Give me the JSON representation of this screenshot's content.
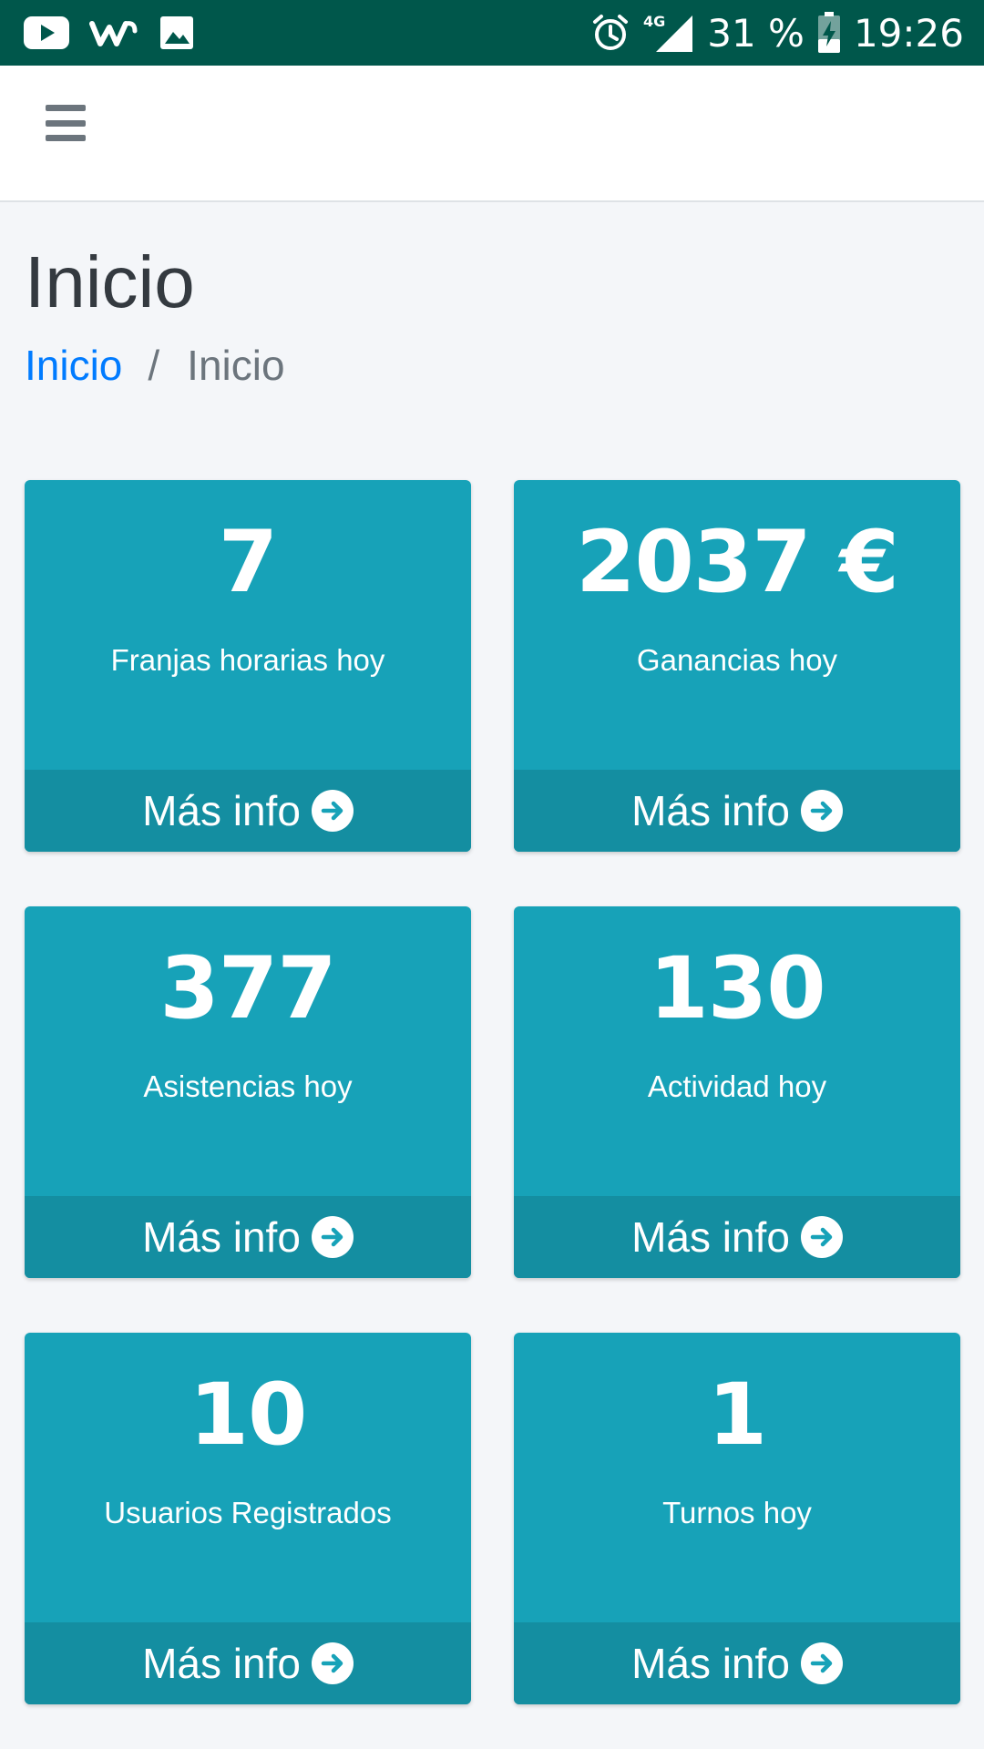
{
  "status_bar": {
    "battery": "31 %",
    "time": "19:26",
    "network": "4G",
    "icons": [
      "youtube-icon",
      "wish-icon",
      "gallery-icon",
      "alarm-icon",
      "signal-icon",
      "battery-charging-icon"
    ]
  },
  "navbar": {
    "menu_icon": "hamburger-menu-icon"
  },
  "header": {
    "title": "Inicio",
    "breadcrumb": {
      "link": "Inicio",
      "separator": "/",
      "current": "Inicio"
    }
  },
  "boxes": [
    {
      "value": "7",
      "label": "Franjas horarias hoy",
      "footer": "Más info"
    },
    {
      "value": "2037 €",
      "label": "Ganancias hoy",
      "footer": "Más info"
    },
    {
      "value": "377",
      "label": "Asistencias hoy",
      "footer": "Más info"
    },
    {
      "value": "130",
      "label": "Actividad hoy",
      "footer": "Más info"
    },
    {
      "value": "10",
      "label": "Usuarios Registrados",
      "footer": "Más info"
    },
    {
      "value": "1",
      "label": "Turnos hoy",
      "footer": "Más info"
    }
  ],
  "colors": {
    "status_bar": "#00574b",
    "box": "#17a2b8",
    "box_footer": "#148ea1",
    "link": "#007bff",
    "page_background": "#f4f6f9"
  }
}
